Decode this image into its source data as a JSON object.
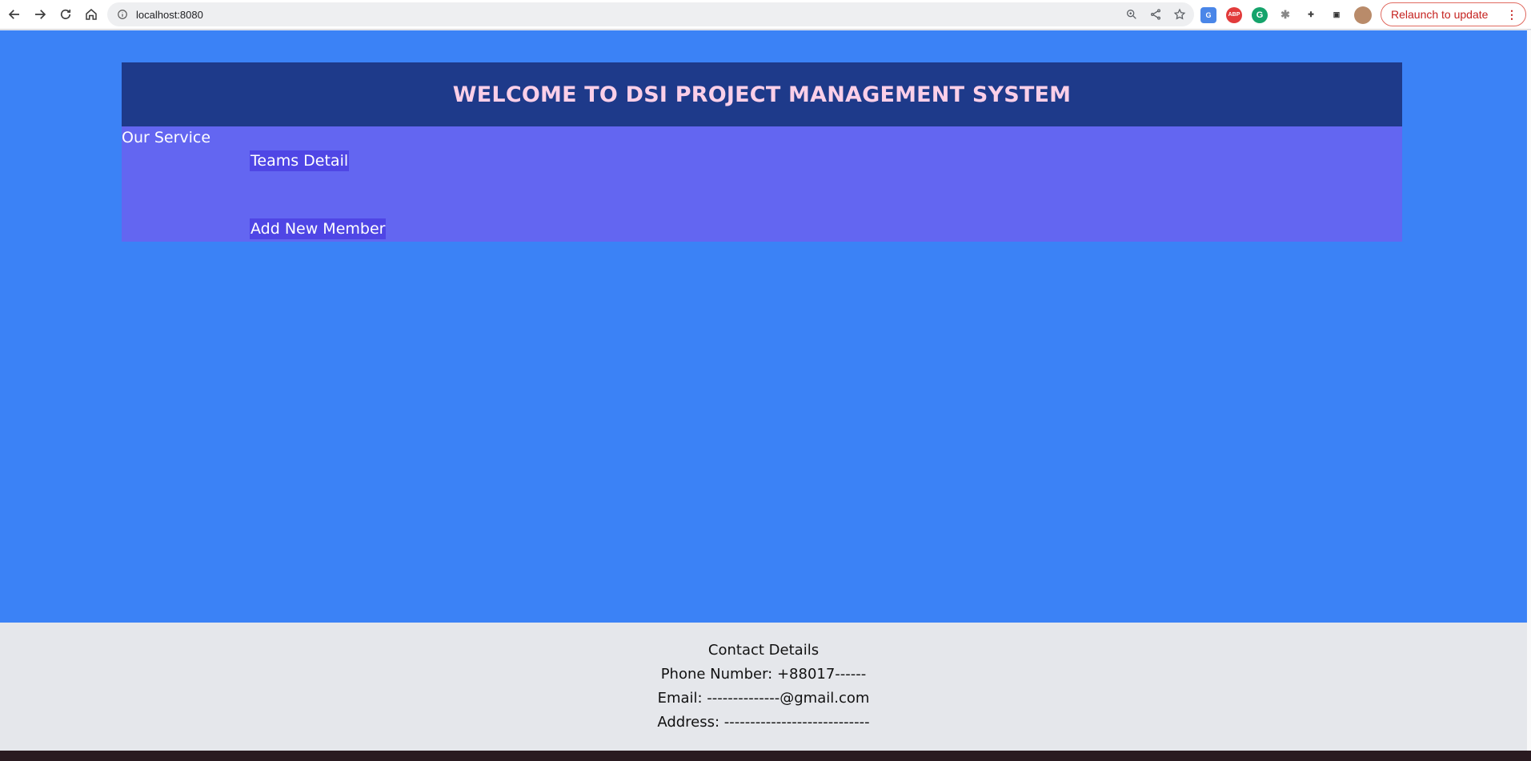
{
  "browser": {
    "url": "localhost:8080",
    "relaunch_label": "Relaunch to update",
    "relaunch_menu": "⋮",
    "extensions": [
      {
        "name": "google-translate-extension",
        "glyph": "G"
      },
      {
        "name": "adblock-plus-extension",
        "glyph": "ABP"
      },
      {
        "name": "grammarly-extension",
        "glyph": "G"
      },
      {
        "name": "bug-extension",
        "glyph": "✱"
      },
      {
        "name": "extensions-puzzle",
        "glyph": "✚"
      },
      {
        "name": "side-panel",
        "glyph": "▣"
      }
    ]
  },
  "header": {
    "title": "WELCOME TO DSI PROJECT MANAGEMENT SYSTEM"
  },
  "services": {
    "label": "Our Service",
    "teams_detail": "Teams Detail",
    "add_member": "Add New Member"
  },
  "footer": {
    "title": "Contact Details",
    "phone": "Phone Number: +88017------",
    "email": "Email: --------------@gmail.com",
    "address": "Address: ----------------------------"
  },
  "colors": {
    "page_bg": "#3b82f6",
    "header_bg": "#1e3a8a",
    "header_text": "#fbcfe8",
    "panel_bg": "#6366f1",
    "link_bg": "#4f46e5",
    "footer_bg": "#e5e7eb"
  }
}
